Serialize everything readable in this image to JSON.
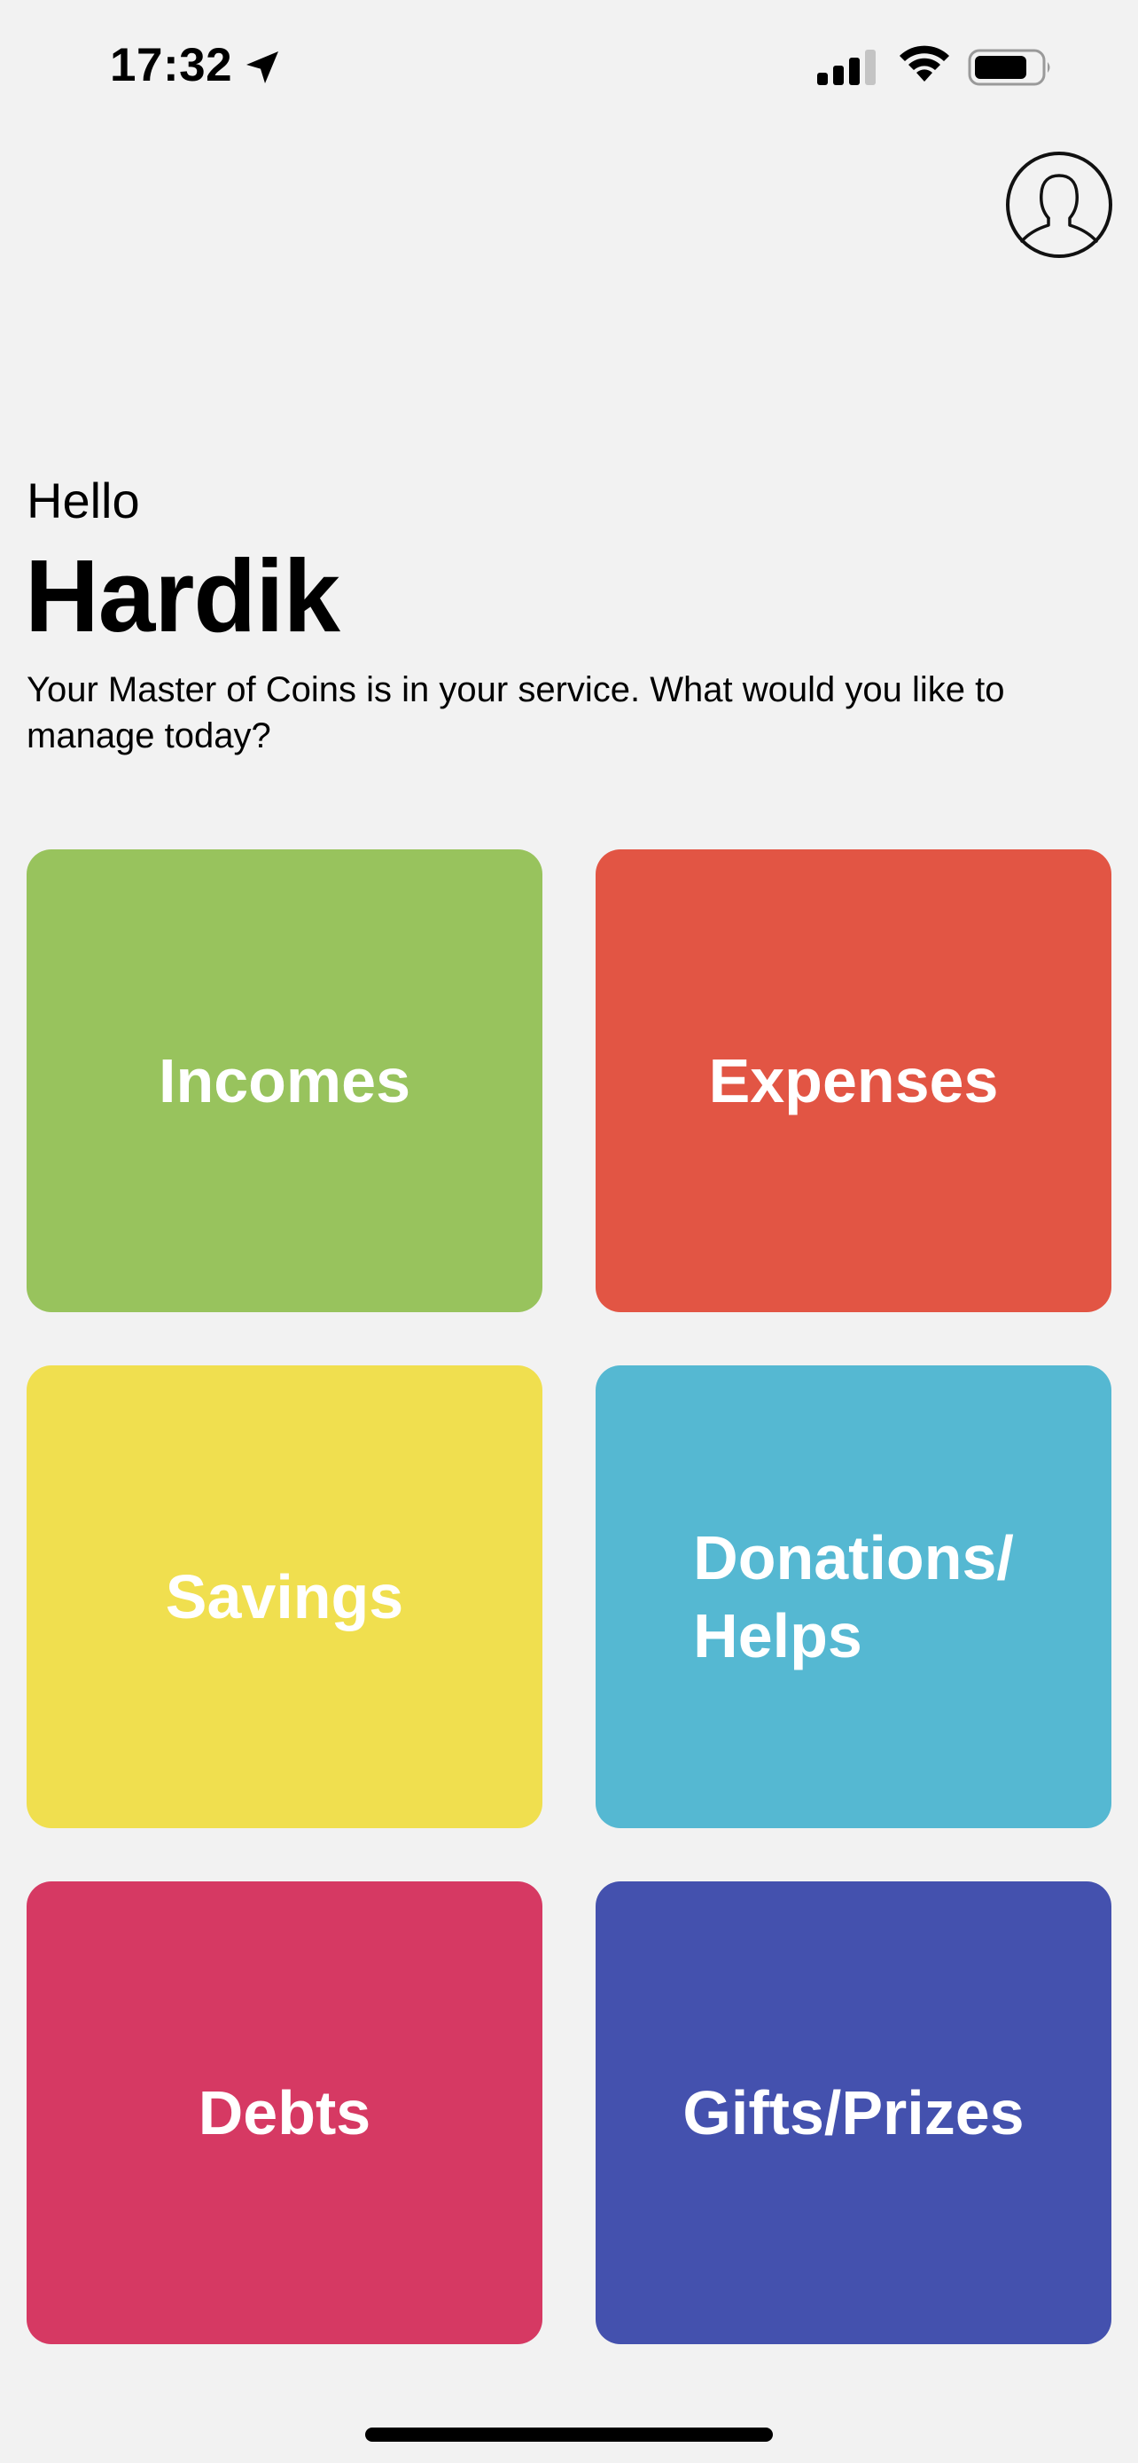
{
  "status_bar": {
    "time": "17:32",
    "icons": [
      "location-arrow-icon",
      "cellular-signal-icon",
      "wifi-icon",
      "battery-icon"
    ]
  },
  "header": {
    "avatar_icon": "user-profile-icon"
  },
  "greeting": {
    "hello": "Hello",
    "name": "Hardik",
    "subtitle": "Your Master of Coins is in your service. What would you like to manage today?"
  },
  "tiles": [
    {
      "label": "Incomes",
      "color": "#98c35d"
    },
    {
      "label": "Expenses",
      "color": "#e25544"
    },
    {
      "label": "Savings",
      "color": "#f0df4f"
    },
    {
      "label": "Donations/\nHelps",
      "color": "#55b8d2"
    },
    {
      "label": "Debts",
      "color": "#d63963"
    },
    {
      "label": "Gifts/Prizes",
      "color": "#4451ae"
    }
  ]
}
